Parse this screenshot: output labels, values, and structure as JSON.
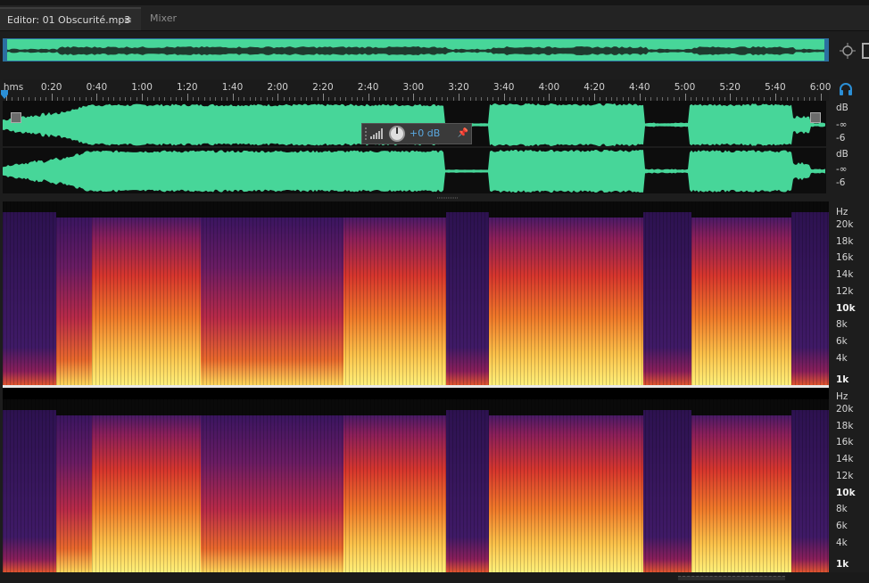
{
  "tabs": {
    "editor_label": "Editor: 01 Obscurité.mp3",
    "mixer_label": "Mixer",
    "menu_icon": "menu-icon"
  },
  "colors": {
    "waveform": "#47d699",
    "spectral_low": "#3a1560",
    "spectral_mid": "#d9402a",
    "spectral_high": "#ffe27a",
    "accent": "#2b8fd6"
  },
  "ruler": {
    "unit_label": "hms",
    "ticks": [
      "0:20",
      "0:40",
      "1:00",
      "1:20",
      "1:40",
      "2:00",
      "2:20",
      "2:40",
      "3:00",
      "3:20",
      "3:40",
      "4:00",
      "4:20",
      "4:40",
      "5:00",
      "5:20",
      "5:40",
      "6:00"
    ]
  },
  "waveform_scale": {
    "channel_1": [
      "dB",
      "-∞",
      "-6"
    ],
    "channel_2": [
      "dB",
      "-∞",
      "-6"
    ]
  },
  "hud": {
    "gain": "+0 dB"
  },
  "spectral_scale": {
    "unit": "Hz",
    "labels": [
      "20k",
      "18k",
      "16k",
      "14k",
      "12k",
      "10k",
      "8k",
      "6k",
      "4k",
      "1k"
    ]
  }
}
